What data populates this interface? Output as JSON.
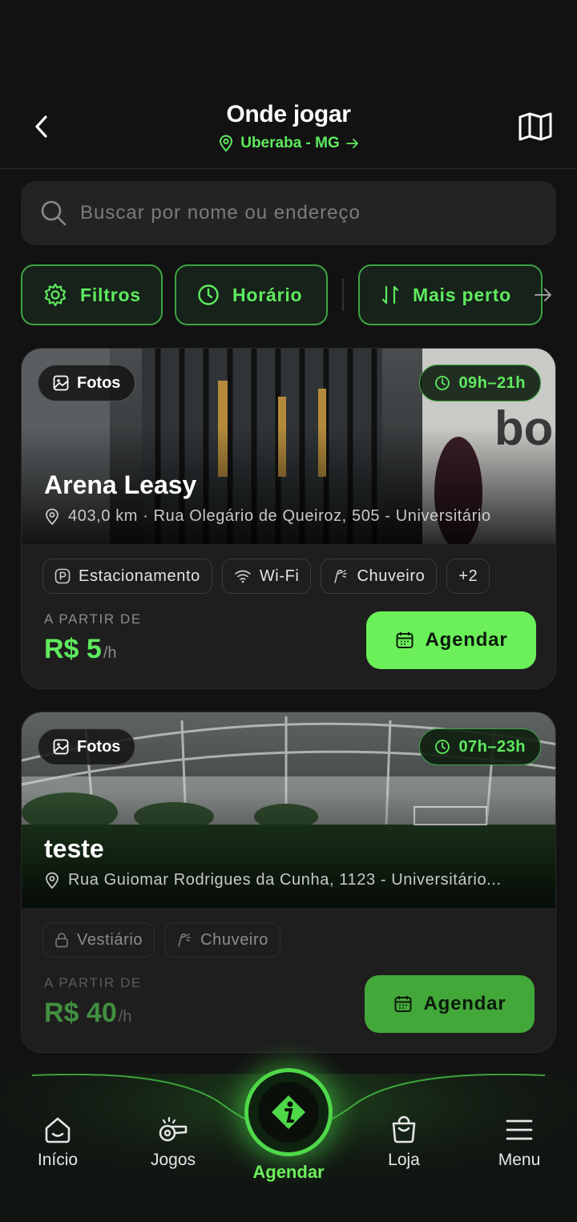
{
  "header": {
    "title": "Onde jogar",
    "location": "Uberaba - MG"
  },
  "search": {
    "placeholder": "Buscar por nome ou endereço"
  },
  "filters": {
    "filters_label": "Filtros",
    "time_label": "Horário",
    "sort_label": "Mais perto"
  },
  "venues": [
    {
      "photos_label": "Fotos",
      "hours": "09h–21h",
      "name": "Arena Leasy",
      "address": "403,0 km · Rua Olegário de Queiroz, 505 - Universitário",
      "amenities": [
        "Estacionamento",
        "Wi-Fi",
        "Chuveiro",
        "+2"
      ],
      "price_label": "A PARTIR DE",
      "price": "R$ 5",
      "price_unit": "/h",
      "book_label": "Agendar"
    },
    {
      "photos_label": "Fotos",
      "hours": "07h–23h",
      "name": "teste",
      "address": "Rua Guiomar Rodrigues da Cunha, 1123 - Universitário...",
      "amenities": [
        "Vestiário",
        "Chuveiro"
      ],
      "price_label": "A PARTIR DE",
      "price": "R$ 40",
      "price_unit": "/h",
      "book_label": "Agendar"
    }
  ],
  "nav": {
    "home": "Início",
    "games": "Jogos",
    "book": "Agendar",
    "store": "Loja",
    "menu": "Menu"
  },
  "colors": {
    "accent": "#5fea5f",
    "background": "#121212",
    "card": "#1e1e1e"
  }
}
